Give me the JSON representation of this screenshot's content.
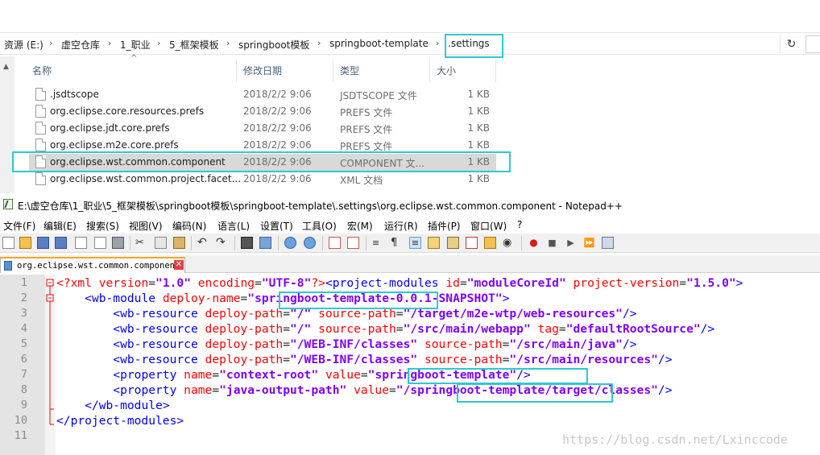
{
  "explorer": {
    "breadcrumbs": [
      "资源 (E:)",
      "虚空仓库",
      "1_职业",
      "5_框架模板",
      "springboot模板",
      "springboot-template",
      ".settings"
    ],
    "columns": {
      "name": "名称",
      "date": "修改日期",
      "type": "类型",
      "size": "大小"
    },
    "files": [
      {
        "name": ".jsdtscope",
        "date": "2018/2/2 9:06",
        "type": "JSDTSCOPE 文件",
        "size": "1 KB"
      },
      {
        "name": "org.eclipse.core.resources.prefs",
        "date": "2018/2/2 9:06",
        "type": "PREFS 文件",
        "size": "1 KB"
      },
      {
        "name": "org.eclipse.jdt.core.prefs",
        "date": "2018/2/2 9:06",
        "type": "PREFS 文件",
        "size": "1 KB"
      },
      {
        "name": "org.eclipse.m2e.core.prefs",
        "date": "2018/2/2 9:06",
        "type": "PREFS 文件",
        "size": "1 KB"
      },
      {
        "name": "org.eclipse.wst.common.component",
        "date": "2018/2/2 9:06",
        "type": "COMPONENT 文...",
        "size": "1 KB"
      },
      {
        "name": "org.eclipse.wst.common.project.facet...",
        "date": "2018/2/2 9:06",
        "type": "XML 文档",
        "size": "1 KB"
      }
    ],
    "refresh_icon": "refresh-icon",
    "highlight_color": "#2cc9d3"
  },
  "notepad": {
    "title": "E:\\虚空仓库\\1_职业\\5_框架模板\\springboot模板\\springboot-template\\.settings\\org.eclipse.wst.common.component - Notepad++",
    "menus": [
      "文件(F)",
      "编辑(E)",
      "搜索(S)",
      "视图(V)",
      "编码(N)",
      "语言(L)",
      "设置(T)",
      "工具(O)",
      "宏(M)",
      "运行(R)",
      "插件(P)",
      "窗口(W)",
      "?"
    ],
    "tab_label": "org.eclipse.wst.common.component",
    "tab_close": "✕",
    "line_numbers": [
      "1",
      "2",
      "3",
      "4",
      "5",
      "6",
      "7",
      "8",
      "9",
      "10",
      "11"
    ],
    "code_lines": [
      "<?xml version=\"1.0\" encoding=\"UTF-8\"?><project-modules id=\"moduleCoreId\" project-version=\"1.5.0\">",
      "    <wb-module deploy-name=\"springboot-template-0.0.1-SNAPSHOT\">",
      "        <wb-resource deploy-path=\"/\" source-path=\"/target/m2e-wtp/web-resources\"/>",
      "        <wb-resource deploy-path=\"/\" source-path=\"/src/main/webapp\" tag=\"defaultRootSource\"/>",
      "        <wb-resource deploy-path=\"/WEB-INF/classes\" source-path=\"/src/main/java\"/>",
      "        <wb-resource deploy-path=\"/WEB-INF/classes\" source-path=\"/src/main/resources\"/>",
      "        <property name=\"context-root\" value=\"springboot-template\"/>",
      "        <property name=\"java-output-path\" value=\"/springboot-template/target/classes\"/>",
      "    </wb-module>",
      "</project-modules>",
      ""
    ]
  },
  "watermark": "https://blog.csdn.net/Lxinccode"
}
